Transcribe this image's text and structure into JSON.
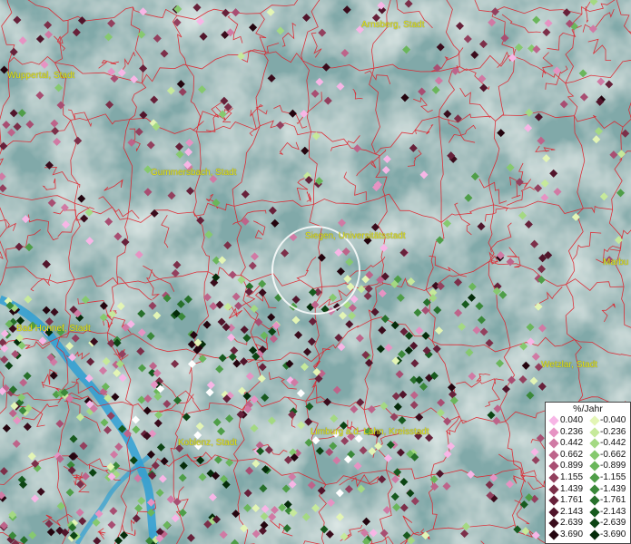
{
  "map": {
    "cities": [
      {
        "name": "Arnsberg, Stadt",
        "key": "arnsberg"
      },
      {
        "name": "Wuppertal, Stadt",
        "key": "wuppertal"
      },
      {
        "name": "Gummersbach, Stadt",
        "key": "gummersbach"
      },
      {
        "name": "Siegen, Universitätsstadt",
        "key": "siegen"
      },
      {
        "name": "Marbu",
        "key": "marburg"
      },
      {
        "name": "Bad Honnef, Stadt",
        "key": "badhonnef"
      },
      {
        "name": "Wetzlar, Stadt",
        "key": "wetzlar"
      },
      {
        "name": "Koblenz, Stadt",
        "key": "koblenz"
      },
      {
        "name": "Limburg a.d. Lahn, Kreisstadt",
        "key": "limburg"
      }
    ]
  },
  "legend": {
    "title": "%/Jahr",
    "positive": [
      "0.040",
      "0.236",
      "0.442",
      "0.662",
      "0.899",
      "1.155",
      "1.439",
      "1.761",
      "2.143",
      "2.639",
      "3.690"
    ],
    "negative": [
      "-0.040",
      "-0.236",
      "-0.442",
      "-0.662",
      "-0.899",
      "-1.155",
      "-1.439",
      "-1.761",
      "-2.143",
      "-2.639",
      "-3.690"
    ],
    "positive_colors": [
      "#f7b6e6",
      "#e693c3",
      "#d07aa4",
      "#bd648a",
      "#a84e72",
      "#93405e",
      "#7c2f49",
      "#67213a",
      "#51152b",
      "#3a0c1c",
      "#24050f"
    ],
    "negative_colors": [
      "#e3f5b5",
      "#c6e99b",
      "#a4d983",
      "#86c96f",
      "#6ab65b",
      "#4f9e48",
      "#3a8839",
      "#27702b",
      "#175a1e",
      "#0c4413",
      "#052c0a"
    ]
  }
}
